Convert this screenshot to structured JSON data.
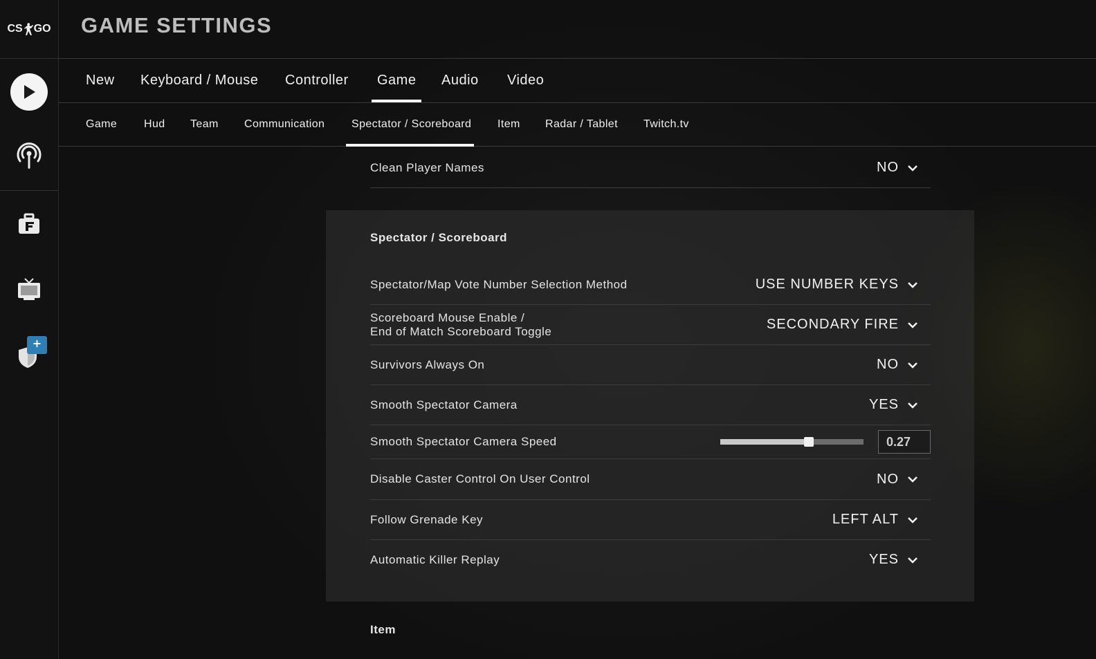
{
  "app": {
    "logo_left": "CS",
    "logo_right": "GO"
  },
  "sidebar": {
    "items": [
      {
        "name": "play",
        "icon": "play-icon"
      },
      {
        "name": "watch",
        "icon": "broadcast-icon"
      },
      {
        "name": "inventory",
        "icon": "briefcase-icon"
      },
      {
        "name": "tv",
        "icon": "tv-icon"
      },
      {
        "name": "operation",
        "icon": "shield-icon",
        "badge": "+"
      }
    ]
  },
  "header": {
    "title": "GAME SETTINGS"
  },
  "tabs": [
    {
      "label": "New",
      "active": false
    },
    {
      "label": "Keyboard / Mouse",
      "active": false
    },
    {
      "label": "Controller",
      "active": false
    },
    {
      "label": "Game",
      "active": true
    },
    {
      "label": "Audio",
      "active": false
    },
    {
      "label": "Video",
      "active": false
    }
  ],
  "subtabs": [
    {
      "label": "Game",
      "active": false
    },
    {
      "label": "Hud",
      "active": false
    },
    {
      "label": "Team",
      "active": false
    },
    {
      "label": "Communication",
      "active": false
    },
    {
      "label": "Spectator / Scoreboard",
      "active": true
    },
    {
      "label": "Item",
      "active": false
    },
    {
      "label": "Radar / Tablet",
      "active": false
    },
    {
      "label": "Twitch.tv",
      "active": false
    }
  ],
  "prev_section": {
    "rows": [
      {
        "label": "Clean Player Names",
        "value": "NO"
      }
    ]
  },
  "spectator_section": {
    "title": "Spectator / Scoreboard",
    "rows": [
      {
        "label": "Spectator/Map Vote Number Selection Method",
        "value": "USE NUMBER KEYS"
      },
      {
        "label_line1": "Scoreboard Mouse Enable /",
        "label_line2": "End of Match Scoreboard Toggle",
        "value": "SECONDARY FIRE"
      },
      {
        "label": "Survivors Always On",
        "value": "NO"
      },
      {
        "label": "Smooth Spectator Camera",
        "value": "YES"
      },
      {
        "label": "Smooth Spectator Camera Speed",
        "slider_value": "0.27",
        "slider_fraction": 0.62
      },
      {
        "label": "Disable Caster Control On User Control",
        "value": "NO"
      },
      {
        "label": "Follow Grenade Key",
        "value": "LEFT ALT"
      },
      {
        "label": "Automatic Killer Replay",
        "value": "YES"
      }
    ]
  },
  "next_section": {
    "title": "Item"
  },
  "colors": {
    "accent": "#f4f4f4",
    "badge": "#2f7fb5",
    "title_grey": "#bdbdbd"
  }
}
